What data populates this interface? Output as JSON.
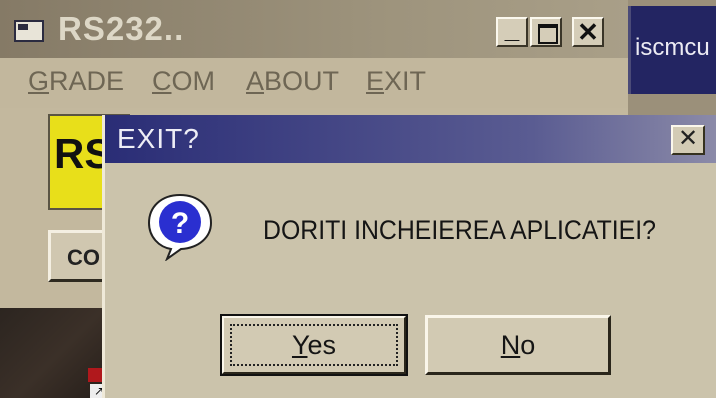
{
  "main_window": {
    "title": "RS232..",
    "controls": {
      "minimize": "_",
      "close": "✕"
    },
    "menu": [
      {
        "label_first": "G",
        "label_rest": "RADE"
      },
      {
        "label_first": "C",
        "label_rest": "OM"
      },
      {
        "label_first": "A",
        "label_rest": "BOUT"
      },
      {
        "label_first": "E",
        "label_rest": "XIT"
      }
    ],
    "panel_label": "RS",
    "co_button": "CO"
  },
  "side_window": {
    "title": "iscmcu"
  },
  "dialog": {
    "title": "EXIT?",
    "close": "✕",
    "icon": "question-icon",
    "message": "DORITI INCHEIEREA APLICATIEI?",
    "buttons": {
      "yes": {
        "first": "Y",
        "rest": "es"
      },
      "no": {
        "first": "N",
        "rest": "o"
      }
    }
  },
  "colors": {
    "dialog_title_bar": "#2a2d76",
    "panel_yellow": "#e8df1a",
    "window_face": "#c4b99f"
  }
}
